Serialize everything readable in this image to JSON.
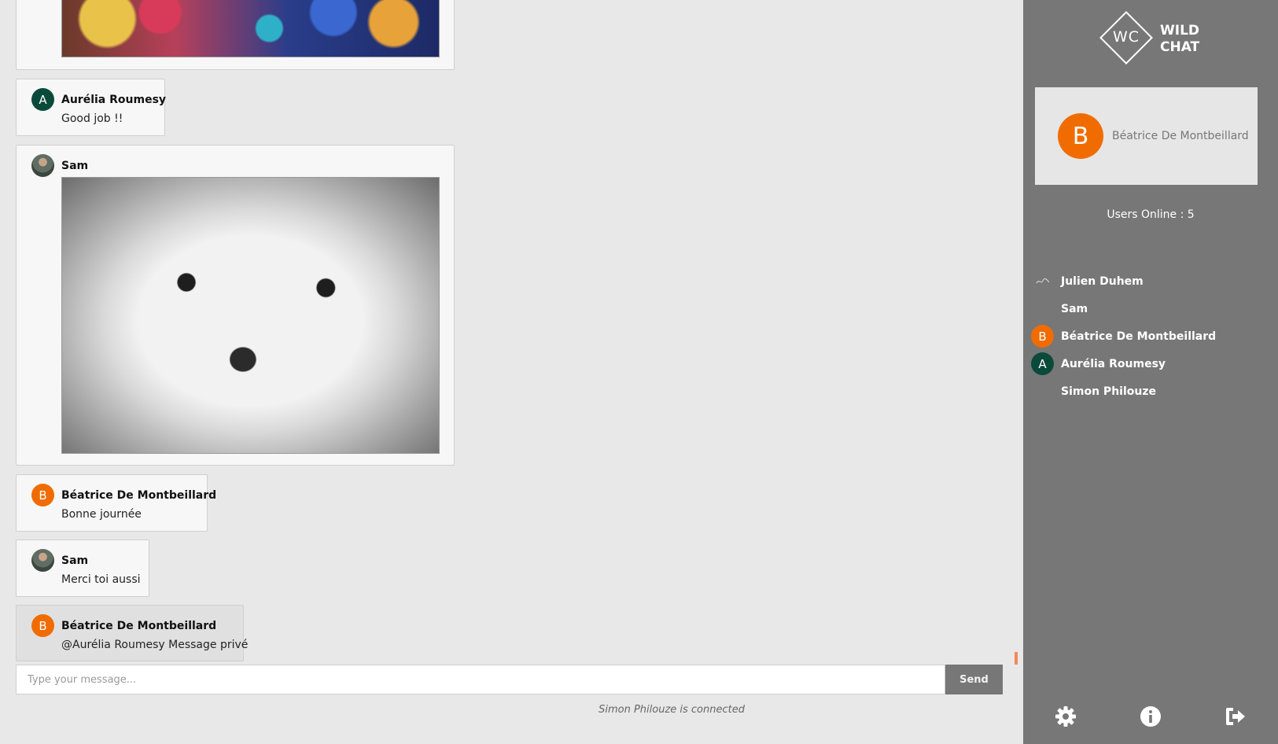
{
  "messages": [
    {
      "id": "party-gif",
      "type": "image",
      "image": "party-gif"
    },
    {
      "author": "Aurélia Roumesy",
      "initial": "A",
      "text": "Good job !!"
    },
    {
      "author": "Sam",
      "type": "image",
      "image": "white-dog-gif"
    },
    {
      "author": "Béatrice De Montbeillard",
      "initial": "B",
      "text": "Bonne journée"
    },
    {
      "author": "Sam",
      "text": "Merci toi aussi"
    },
    {
      "author": "Béatrice De Montbeillard",
      "initial": "B",
      "text": "@Aurélia Roumesy Message privé",
      "private": true
    }
  ],
  "composer": {
    "placeholder": "Type your message...",
    "send_label": "Send"
  },
  "status": "Simon Philouze is connected",
  "sidebar": {
    "logo": {
      "mark": "WC",
      "line1": "WILD",
      "line2": "CHAT"
    },
    "current_user": {
      "name": "Béatrice De Montbeillard",
      "initial": "B"
    },
    "users_online_label": "Users Online : 5",
    "users": [
      {
        "name": "Julien Duhem",
        "avatar": "photo"
      },
      {
        "name": "Sam",
        "avatar": "photo"
      },
      {
        "name": "Béatrice De Montbeillard",
        "initial": "B"
      },
      {
        "name": "Aurélia Roumesy",
        "initial": "A"
      },
      {
        "name": "Simon Philouze",
        "avatar": "photo"
      }
    ],
    "footer_icons": [
      "settings-icon",
      "info-icon",
      "logout-icon"
    ]
  },
  "colors": {
    "accent_orange": "#f06c00",
    "teal": "#0b4a3a",
    "sidebar_bg": "#777777",
    "chat_bg": "#e8e8e8"
  }
}
